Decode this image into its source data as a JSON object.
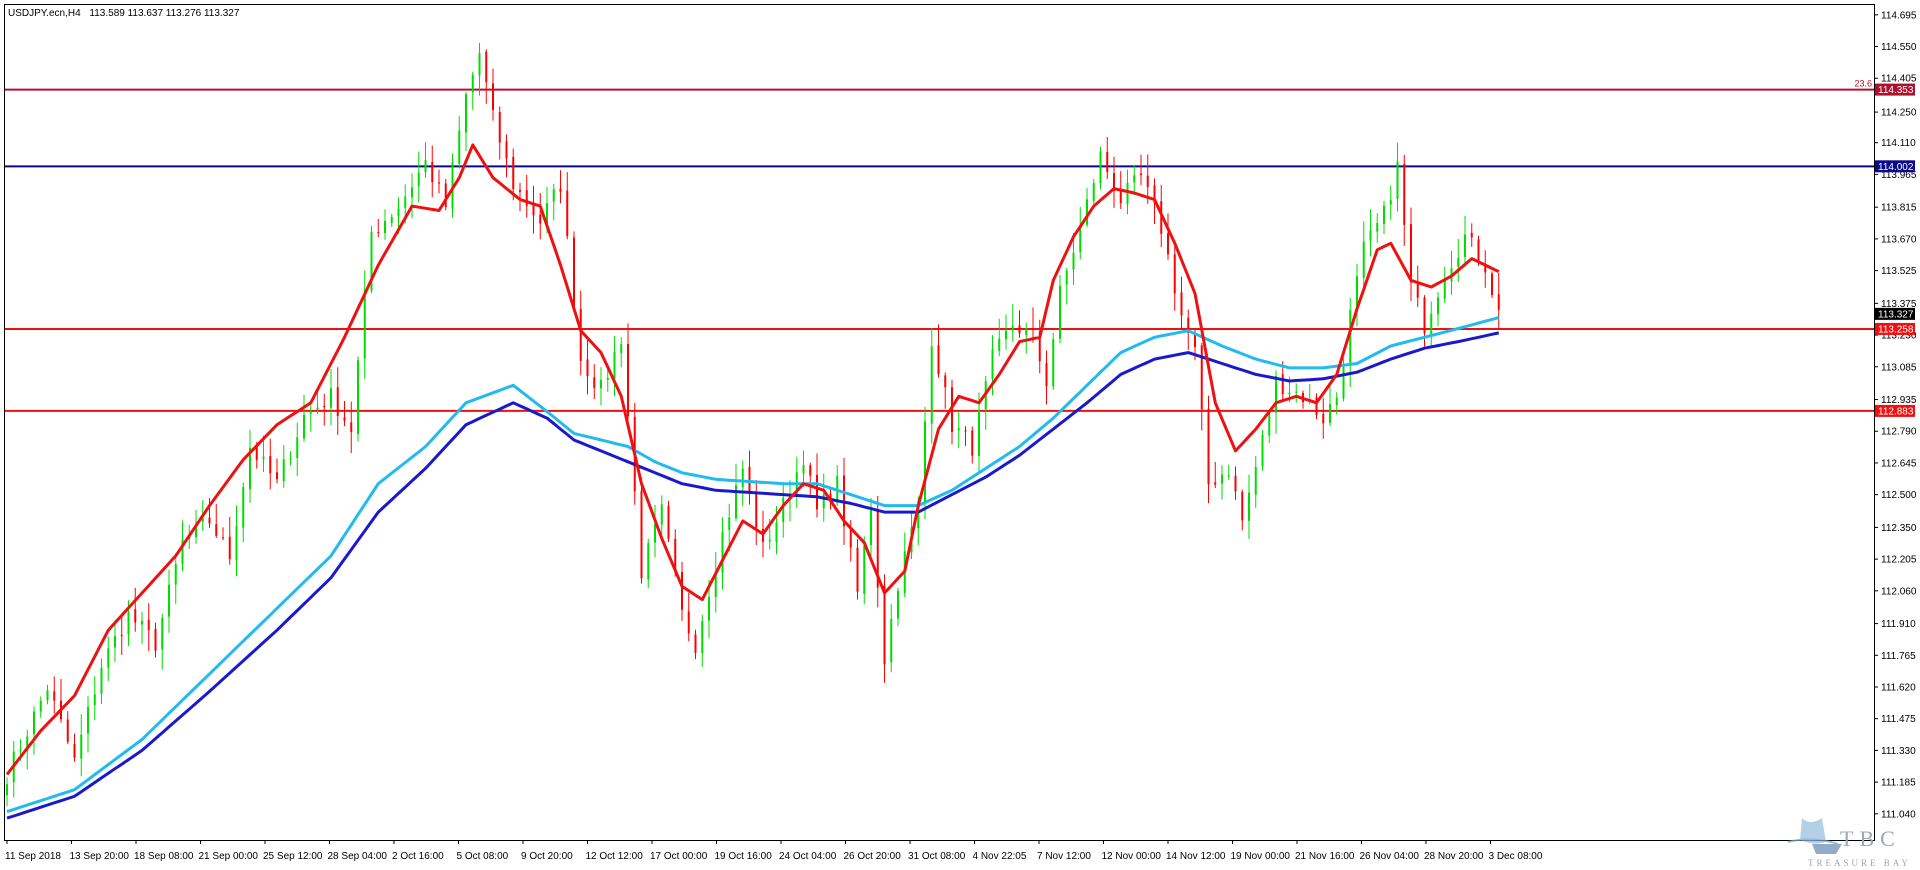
{
  "header": {
    "symbol": "USDJPY.ecn,H4",
    "ohlc": "113.589 113.637 113.276 113.327"
  },
  "watermark": {
    "logo": "TBC",
    "name": "TREASURE BAY"
  },
  "colors": {
    "up": "#00dd00",
    "down": "#ff0000",
    "ma_fast": "#ee1111",
    "ma_light": "#22bbee",
    "ma_dark": "#1a1acc",
    "level_red": "#ee1111",
    "level_navy": "#0a0a8a",
    "level_maroon": "#b01030",
    "current_tag": "#000000"
  },
  "chart_data": {
    "type": "candlestick",
    "title": "",
    "y_ticks": [
      "114.695",
      "114.550",
      "114.405",
      "114.250",
      "114.110",
      "113.965",
      "113.815",
      "113.670",
      "113.525",
      "113.375",
      "113.230",
      "113.085",
      "112.935",
      "112.790",
      "112.645",
      "112.500",
      "112.350",
      "112.205",
      "112.060",
      "111.910",
      "111.765",
      "111.620",
      "111.475",
      "111.330",
      "111.185",
      "111.040"
    ],
    "x_ticks": [
      "11 Sep 2018",
      "13 Sep 20:00",
      "18 Sep 08:00",
      "21 Sep 00:00",
      "25 Sep 12:00",
      "28 Sep 04:00",
      "2 Oct 16:00",
      "5 Oct 08:00",
      "9 Oct 20:00",
      "12 Oct 12:00",
      "17 Oct 00:00",
      "19 Oct 16:00",
      "24 Oct 04:00",
      "26 Oct 20:00",
      "31 Oct 08:00",
      "4 Nov 22:05",
      "7 Nov 12:00",
      "12 Nov 00:00",
      "14 Nov 12:00",
      "19 Nov 00:00",
      "21 Nov 16:00",
      "26 Nov 04:00",
      "28 Nov 20:00",
      "3 Dec 08:00"
    ],
    "y_range": [
      110.92,
      114.74
    ],
    "levels": [
      {
        "price": 114.353,
        "label": "114.353",
        "color": "maroon",
        "fib_label": "23.6"
      },
      {
        "price": 114.002,
        "label": "114.002",
        "color": "navy"
      },
      {
        "price": 113.258,
        "label": "113.258",
        "color": "red"
      },
      {
        "price": 112.883,
        "label": "112.883",
        "color": "red"
      }
    ],
    "current_price": {
      "price": 113.327,
      "label": "113.327"
    },
    "close_path": [
      [
        0,
        111.22
      ],
      [
        6,
        111.62
      ],
      [
        10,
        111.28
      ],
      [
        14,
        111.72
      ],
      [
        18,
        111.95
      ],
      [
        22,
        111.82
      ],
      [
        26,
        112.28
      ],
      [
        30,
        112.38
      ],
      [
        33,
        112.22
      ],
      [
        36,
        112.72
      ],
      [
        40,
        112.55
      ],
      [
        44,
        112.86
      ],
      [
        48,
        112.95
      ],
      [
        51,
        112.8
      ],
      [
        54,
        113.7
      ],
      [
        58,
        113.82
      ],
      [
        62,
        114.02
      ],
      [
        65,
        113.82
      ],
      [
        68,
        114.32
      ],
      [
        70,
        114.52
      ],
      [
        72,
        114.22
      ],
      [
        75,
        113.92
      ],
      [
        79,
        113.75
      ],
      [
        82,
        113.92
      ],
      [
        85,
        113.12
      ],
      [
        88,
        112.98
      ],
      [
        91,
        113.22
      ],
      [
        94,
        112.15
      ],
      [
        97,
        112.42
      ],
      [
        100,
        111.95
      ],
      [
        102,
        111.82
      ],
      [
        106,
        112.32
      ],
      [
        109,
        112.62
      ],
      [
        112,
        112.25
      ],
      [
        115,
        112.45
      ],
      [
        118,
        112.68
      ],
      [
        120,
        112.42
      ],
      [
        123,
        112.55
      ],
      [
        126,
        112.05
      ],
      [
        128,
        112.45
      ],
      [
        130,
        111.75
      ],
      [
        132,
        112.1
      ],
      [
        135,
        112.45
      ],
      [
        137,
        113.22
      ],
      [
        140,
        112.82
      ],
      [
        143,
        112.72
      ],
      [
        146,
        113.12
      ],
      [
        149,
        113.28
      ],
      [
        152,
        113.22
      ],
      [
        154,
        113.02
      ],
      [
        156,
        113.42
      ],
      [
        159,
        113.72
      ],
      [
        162,
        114.05
      ],
      [
        165,
        113.85
      ],
      [
        168,
        113.95
      ],
      [
        171,
        113.72
      ],
      [
        174,
        113.32
      ],
      [
        176,
        113.15
      ],
      [
        178,
        112.55
      ],
      [
        181,
        112.62
      ],
      [
        183,
        112.38
      ],
      [
        186,
        112.75
      ],
      [
        188,
        113.02
      ],
      [
        192,
        112.95
      ],
      [
        195,
        112.85
      ],
      [
        197,
        112.95
      ],
      [
        199,
        113.32
      ],
      [
        201,
        113.62
      ],
      [
        204,
        113.78
      ],
      [
        206,
        114.0
      ],
      [
        208,
        113.45
      ],
      [
        210,
        113.28
      ],
      [
        213,
        113.52
      ],
      [
        216,
        113.68
      ],
      [
        219,
        113.55
      ],
      [
        221,
        113.33
      ]
    ],
    "ma_fast_path": [
      [
        0,
        111.22
      ],
      [
        5,
        111.42
      ],
      [
        10,
        111.58
      ],
      [
        15,
        111.88
      ],
      [
        20,
        112.05
      ],
      [
        25,
        112.22
      ],
      [
        30,
        112.45
      ],
      [
        35,
        112.66
      ],
      [
        40,
        112.82
      ],
      [
        45,
        112.92
      ],
      [
        50,
        113.22
      ],
      [
        55,
        113.55
      ],
      [
        60,
        113.82
      ],
      [
        64,
        113.8
      ],
      [
        67,
        113.95
      ],
      [
        69,
        114.1
      ],
      [
        72,
        113.95
      ],
      [
        76,
        113.85
      ],
      [
        79,
        113.82
      ],
      [
        82,
        113.55
      ],
      [
        85,
        113.25
      ],
      [
        88,
        113.15
      ],
      [
        91,
        112.95
      ],
      [
        94,
        112.55
      ],
      [
        97,
        112.3
      ],
      [
        100,
        112.08
      ],
      [
        103,
        112.02
      ],
      [
        106,
        112.2
      ],
      [
        109,
        112.38
      ],
      [
        112,
        112.32
      ],
      [
        115,
        112.45
      ],
      [
        118,
        112.55
      ],
      [
        121,
        112.52
      ],
      [
        124,
        112.38
      ],
      [
        127,
        112.28
      ],
      [
        130,
        112.05
      ],
      [
        133,
        112.15
      ],
      [
        135,
        112.45
      ],
      [
        138,
        112.8
      ],
      [
        141,
        112.95
      ],
      [
        144,
        112.92
      ],
      [
        147,
        113.05
      ],
      [
        150,
        113.2
      ],
      [
        153,
        113.22
      ],
      [
        155,
        113.48
      ],
      [
        158,
        113.68
      ],
      [
        161,
        113.82
      ],
      [
        164,
        113.9
      ],
      [
        167,
        113.88
      ],
      [
        170,
        113.85
      ],
      [
        173,
        113.65
      ],
      [
        176,
        113.42
      ],
      [
        179,
        112.92
      ],
      [
        182,
        112.7
      ],
      [
        185,
        112.8
      ],
      [
        188,
        112.92
      ],
      [
        191,
        112.95
      ],
      [
        194,
        112.92
      ],
      [
        197,
        113.05
      ],
      [
        200,
        113.35
      ],
      [
        203,
        113.62
      ],
      [
        205,
        113.65
      ],
      [
        208,
        113.48
      ],
      [
        211,
        113.45
      ],
      [
        214,
        113.5
      ],
      [
        217,
        113.58
      ],
      [
        221,
        113.52
      ]
    ],
    "ma_light_path": [
      [
        0,
        111.05
      ],
      [
        10,
        111.15
      ],
      [
        20,
        111.38
      ],
      [
        30,
        111.68
      ],
      [
        40,
        111.98
      ],
      [
        48,
        112.22
      ],
      [
        55,
        112.55
      ],
      [
        62,
        112.72
      ],
      [
        68,
        112.92
      ],
      [
        75,
        113.0
      ],
      [
        80,
        112.88
      ],
      [
        84,
        112.78
      ],
      [
        88,
        112.75
      ],
      [
        92,
        112.72
      ],
      [
        96,
        112.65
      ],
      [
        100,
        112.6
      ],
      [
        105,
        112.57
      ],
      [
        110,
        112.56
      ],
      [
        115,
        112.55
      ],
      [
        120,
        112.55
      ],
      [
        125,
        112.5
      ],
      [
        130,
        112.45
      ],
      [
        135,
        112.45
      ],
      [
        140,
        112.52
      ],
      [
        145,
        112.62
      ],
      [
        150,
        112.72
      ],
      [
        155,
        112.85
      ],
      [
        160,
        113.0
      ],
      [
        165,
        113.15
      ],
      [
        170,
        113.22
      ],
      [
        175,
        113.25
      ],
      [
        180,
        113.18
      ],
      [
        185,
        113.12
      ],
      [
        190,
        113.08
      ],
      [
        195,
        113.08
      ],
      [
        200,
        113.1
      ],
      [
        205,
        113.18
      ],
      [
        210,
        113.22
      ],
      [
        215,
        113.26
      ],
      [
        221,
        113.31
      ]
    ],
    "ma_dark_path": [
      [
        0,
        111.02
      ],
      [
        10,
        111.12
      ],
      [
        20,
        111.33
      ],
      [
        30,
        111.6
      ],
      [
        40,
        111.88
      ],
      [
        48,
        112.12
      ],
      [
        55,
        112.42
      ],
      [
        62,
        112.62
      ],
      [
        68,
        112.82
      ],
      [
        75,
        112.92
      ],
      [
        80,
        112.85
      ],
      [
        84,
        112.75
      ],
      [
        88,
        112.7
      ],
      [
        92,
        112.65
      ],
      [
        96,
        112.6
      ],
      [
        100,
        112.55
      ],
      [
        105,
        112.52
      ],
      [
        110,
        112.51
      ],
      [
        115,
        112.5
      ],
      [
        120,
        112.49
      ],
      [
        125,
        112.46
      ],
      [
        130,
        112.42
      ],
      [
        135,
        112.42
      ],
      [
        140,
        112.5
      ],
      [
        145,
        112.58
      ],
      [
        150,
        112.68
      ],
      [
        155,
        112.8
      ],
      [
        160,
        112.92
      ],
      [
        165,
        113.05
      ],
      [
        170,
        113.12
      ],
      [
        175,
        113.15
      ],
      [
        180,
        113.1
      ],
      [
        185,
        113.05
      ],
      [
        190,
        113.02
      ],
      [
        195,
        113.03
      ],
      [
        200,
        113.06
      ],
      [
        205,
        113.12
      ],
      [
        210,
        113.17
      ],
      [
        215,
        113.2
      ],
      [
        221,
        113.24
      ]
    ]
  }
}
